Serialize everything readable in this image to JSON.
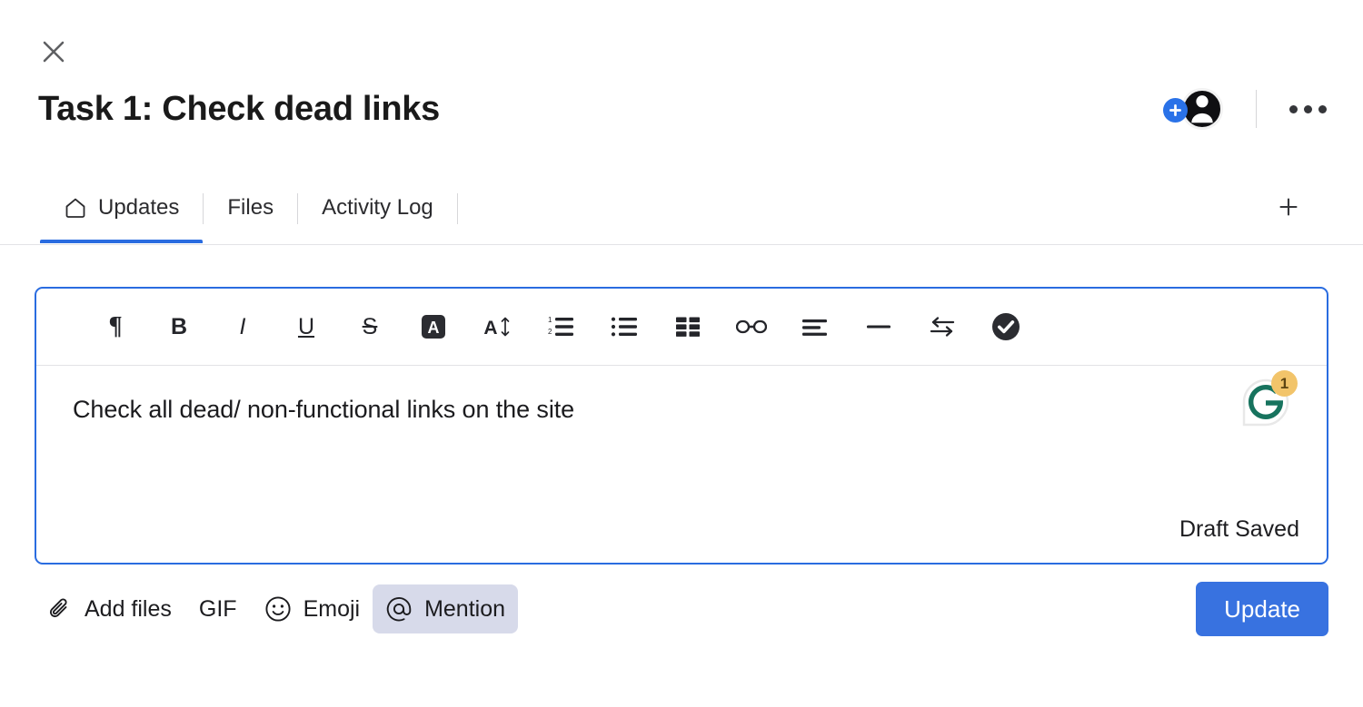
{
  "header": {
    "close_label": "close-icon",
    "title": "Task 1: Check dead links",
    "add_member_label": "+",
    "more_menu_label": "more-options"
  },
  "tabs": {
    "items": [
      {
        "label": "Updates",
        "icon": "home-icon",
        "active": true
      },
      {
        "label": "Files",
        "icon": "",
        "active": false
      },
      {
        "label": "Activity Log",
        "icon": "",
        "active": false
      }
    ],
    "add_tab_label": "+"
  },
  "toolbar": {
    "buttons": [
      {
        "name": "paragraph-style-button",
        "glyph": "¶",
        "label": "Paragraph"
      },
      {
        "name": "bold-button",
        "glyph": "B",
        "label": "Bold"
      },
      {
        "name": "italic-button",
        "glyph": "I",
        "label": "Italic"
      },
      {
        "name": "underline-button",
        "glyph": "U",
        "label": "Underline"
      },
      {
        "name": "strikethrough-button",
        "glyph": "S",
        "label": "Strikethrough"
      },
      {
        "name": "text-color-button",
        "glyph": "A",
        "label": "Text color"
      },
      {
        "name": "font-size-button",
        "glyph": "A",
        "label": "Font size"
      },
      {
        "name": "numbered-list-button",
        "glyph": "",
        "label": "Numbered list"
      },
      {
        "name": "bulleted-list-button",
        "glyph": "",
        "label": "Bulleted list"
      },
      {
        "name": "table-button",
        "glyph": "",
        "label": "Table"
      },
      {
        "name": "link-button",
        "glyph": "",
        "label": "Link"
      },
      {
        "name": "align-button",
        "glyph": "",
        "label": "Align"
      },
      {
        "name": "horizontal-rule-button",
        "glyph": "",
        "label": "Horizontal rule"
      },
      {
        "name": "swap-button",
        "glyph": "",
        "label": "Swap"
      },
      {
        "name": "checkmark-button",
        "glyph": "",
        "label": "Done"
      }
    ]
  },
  "editor": {
    "content": "Check all dead/ non-functional links on the site",
    "draft_status": "Draft Saved",
    "grammarly": {
      "name": "grammarly-icon",
      "alert_count": "1"
    }
  },
  "footer": {
    "actions": [
      {
        "name": "add-files-button",
        "label": "Add files",
        "icon": "paperclip-icon",
        "highlight": false
      },
      {
        "name": "gif-button",
        "label": "GIF",
        "icon": "",
        "highlight": false
      },
      {
        "name": "emoji-button",
        "label": "Emoji",
        "icon": "smiley-icon",
        "highlight": false
      },
      {
        "name": "mention-button",
        "label": "Mention",
        "icon": "at-icon",
        "highlight": true
      }
    ],
    "update_label": "Update"
  },
  "colors": {
    "accent_blue": "#2a6ce0",
    "update_blue": "#3872e0",
    "mention_highlight": "#d7daea",
    "grammarly_green": "#17735e",
    "badge_amber": "#f2c46a",
    "text_dark": "#1b1b1e"
  }
}
